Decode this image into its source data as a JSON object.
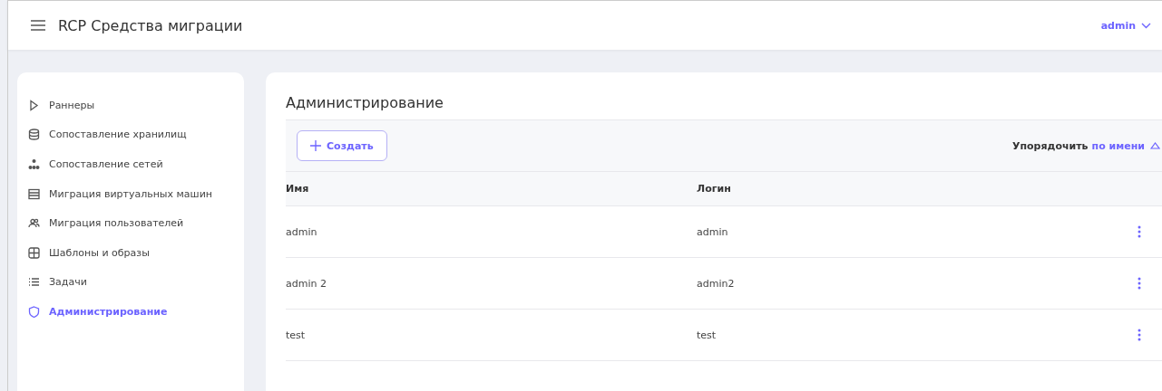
{
  "header": {
    "title": "RCP Средства миграции",
    "user": "admin"
  },
  "sidebar": {
    "items": [
      {
        "label": "Раннеры",
        "selected": false
      },
      {
        "label": "Сопоставление хранилищ",
        "selected": false
      },
      {
        "label": "Сопоставление сетей",
        "selected": false
      },
      {
        "label": "Миграция виртуальных машин",
        "selected": false
      },
      {
        "label": "Миграция пользователей",
        "selected": false
      },
      {
        "label": "Шаблоны и образы",
        "selected": false
      },
      {
        "label": "Задачи",
        "selected": false
      },
      {
        "label": "Администрирование",
        "selected": true
      }
    ]
  },
  "page": {
    "title": "Администрирование",
    "create_button": "Создать",
    "sort": {
      "label": "Упорядочить",
      "value": "по имени"
    }
  },
  "table": {
    "columns": [
      "Имя",
      "Логин"
    ],
    "rows": [
      {
        "cells": [
          "admin",
          "admin"
        ]
      },
      {
        "cells": [
          "admin 2",
          "admin2"
        ]
      },
      {
        "cells": [
          "test",
          "test"
        ]
      }
    ]
  }
}
